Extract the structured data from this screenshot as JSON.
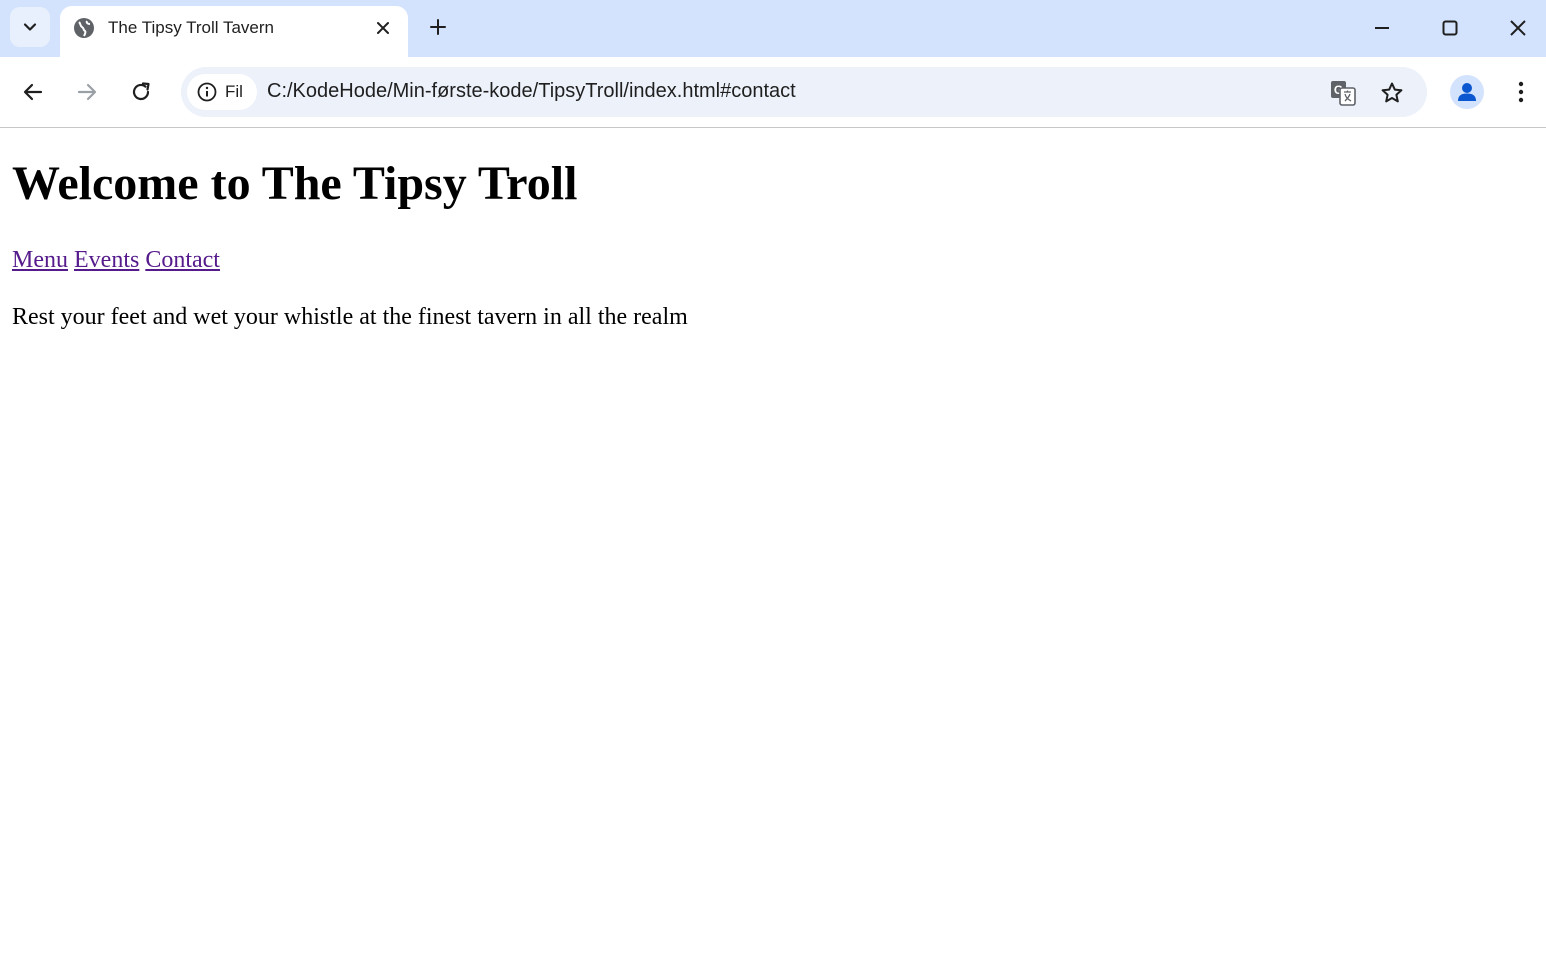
{
  "browser": {
    "tab": {
      "title": "The Tipsy Troll Tavern"
    },
    "omnibox": {
      "site_info_label": "Fil",
      "url": "C:/KodeHode/Min-første-kode/TipsyTroll/index.html#contact"
    },
    "colors": {
      "titlebar": "#d3e3fd",
      "omnibox": "#ecf1fa",
      "profile_icon": "#0b57d0"
    },
    "icons": [
      "tab-search-icon",
      "globe-icon",
      "close-icon",
      "plus-icon",
      "minimize-icon",
      "maximize-icon",
      "window-close-icon",
      "back-arrow-icon",
      "forward-arrow-icon",
      "reload-icon",
      "info-icon",
      "translate-icon",
      "star-icon",
      "profile-icon",
      "kebab-menu-icon"
    ]
  },
  "page": {
    "heading": "Welcome to The Tipsy Troll",
    "nav": {
      "menu": "Menu",
      "events": "Events",
      "contact": "Contact"
    },
    "tagline": "Rest your feet and wet your whistle at the finest tavern in all the realm",
    "link_color": "#551a8b"
  }
}
